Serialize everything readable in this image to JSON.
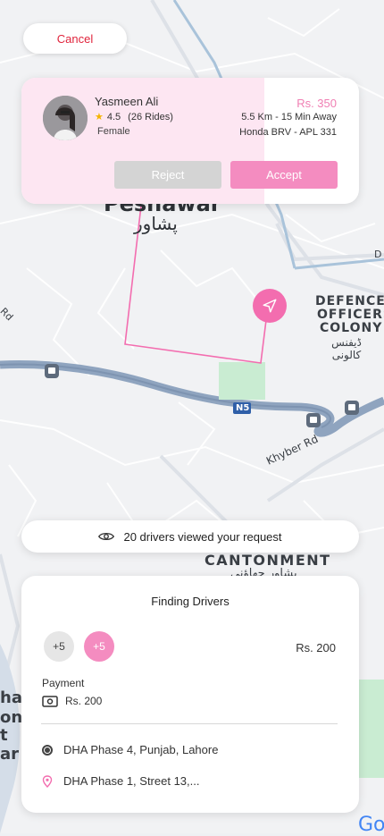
{
  "colors": {
    "accent": "#f36daf",
    "accent_soft": "#f48cc0",
    "cancel_red": "#e0243c",
    "road_blue": "#8fa4bf",
    "route_pink": "#f36daf"
  },
  "top": {
    "cancel_label": "Cancel"
  },
  "request": {
    "name": "Yasmeen Ali",
    "rating": "4.5",
    "rides": "(26 Rides)",
    "gender": "Female",
    "price": "Rs. 350",
    "distance_time": "5.5 Km - 15 Min Away",
    "car": "Honda BRV - APL 331",
    "reject_label": "Reject",
    "accept_label": "Accept"
  },
  "map": {
    "city_en": "Peshawar",
    "city_ur": "پشاور",
    "area1": "DEFENCE",
    "area2": "OFFICERS",
    "area3": "COLONY",
    "area_ur": "ڈیفنس کالونی",
    "road_n5": "N5",
    "road_khyber": "Khyber Rd",
    "rd": "Rd",
    "cantonment": "CANTONMENT",
    "cantonment_ur": "پشاور چھاؤنی",
    "d_label": "D",
    "left_labels": [
      "har",
      "ona",
      "t",
      "ar"
    ],
    "google": "Go"
  },
  "viewed": {
    "text": "20 drivers viewed your request",
    "icon": "eye-icon"
  },
  "bottom": {
    "title": "Finding Drivers",
    "chip1": "+5",
    "chip2": "+5",
    "fare": "Rs. 200",
    "payment_label": "Payment",
    "payment_value": "Rs. 200",
    "pickup": "DHA Phase 4, Punjab, Lahore",
    "dropoff": "DHA Phase 1, Street 13,..."
  }
}
